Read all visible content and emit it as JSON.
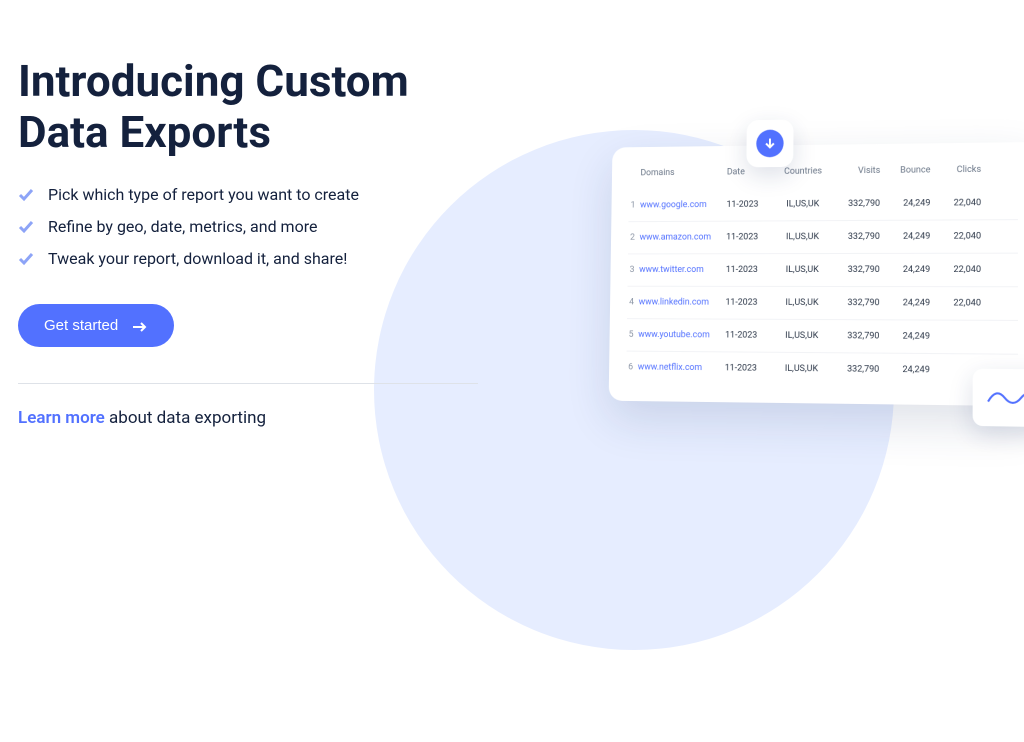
{
  "heading_line1": "Introducing Custom",
  "heading_line2": "Data Exports",
  "features": [
    "Pick which type of report you want to create",
    "Refine by geo, date, metrics, and more",
    "Tweak your report, download it, and share!"
  ],
  "cta": "Get started",
  "learn_more": "Learn more",
  "learn_more_suffix": " about data exporting",
  "table": {
    "headers": {
      "domains": "Domains",
      "date": "Date",
      "countries": "Countries",
      "visits": "Visits",
      "bounce": "Bounce",
      "clicks": "Clicks"
    },
    "rows": [
      {
        "idx": "1",
        "domain": "www.google.com",
        "date": "11-2023",
        "countries": "IL,US,UK",
        "visits": "332,790",
        "bounce": "24,249",
        "clicks": "22,040"
      },
      {
        "idx": "2",
        "domain": "www.amazon.com",
        "date": "11-2023",
        "countries": "IL,US,UK",
        "visits": "332,790",
        "bounce": "24,249",
        "clicks": "22,040"
      },
      {
        "idx": "3",
        "domain": "www.twitter.com",
        "date": "11-2023",
        "countries": "IL,US,UK",
        "visits": "332,790",
        "bounce": "24,249",
        "clicks": "22,040"
      },
      {
        "idx": "4",
        "domain": "www.linkedin.com",
        "date": "11-2023",
        "countries": "IL,US,UK",
        "visits": "332,790",
        "bounce": "24,249",
        "clicks": "22,040"
      },
      {
        "idx": "5",
        "domain": "www.youtube.com",
        "date": "11-2023",
        "countries": "IL,US,UK",
        "visits": "332,790",
        "bounce": "24,249",
        "clicks": ""
      },
      {
        "idx": "6",
        "domain": "www.netflix.com",
        "date": "11-2023",
        "countries": "IL,US,UK",
        "visits": "332,790",
        "bounce": "24,249",
        "clicks": ""
      }
    ]
  }
}
